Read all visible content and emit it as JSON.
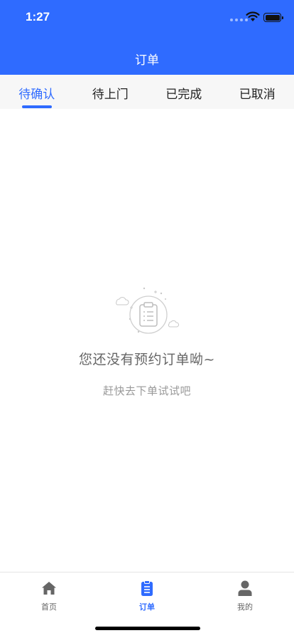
{
  "status_bar": {
    "time": "1:27"
  },
  "header": {
    "title": "订单"
  },
  "tabs": [
    {
      "label": "待确认",
      "active": true
    },
    {
      "label": "待上门",
      "active": false
    },
    {
      "label": "已完成",
      "active": false
    },
    {
      "label": "已取消",
      "active": false
    }
  ],
  "empty_state": {
    "title": "您还没有预约订单呦~",
    "subtitle": "赶快去下单试试吧",
    "icon": "empty-order-illustration"
  },
  "tabbar": [
    {
      "label": "首页",
      "icon": "home-icon",
      "active": false
    },
    {
      "label": "订单",
      "icon": "clipboard-icon",
      "active": true
    },
    {
      "label": "我的",
      "icon": "user-icon",
      "active": false
    }
  ],
  "colors": {
    "primary": "#2f6bff",
    "tab_background": "#f7f7f7",
    "inactive_icon": "#666666"
  }
}
